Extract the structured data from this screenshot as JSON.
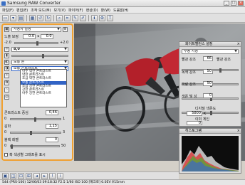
{
  "window": {
    "title": "Samsung RAW Converter",
    "minimize": "_",
    "maximize": "□",
    "close": "×"
  },
  "menu": [
    "파일(F)",
    "편집(E)",
    "조작 모드(M)",
    "보기(V)",
    "파이어(F)",
    "현상(D)",
    "창(W)",
    "도움말(H)"
  ],
  "toolbar_icons": [
    "folder-icon",
    "save-icon",
    "print-icon",
    "grid-icon",
    "rotate-left-icon",
    "rotate-right-icon",
    "zoom-icon",
    "crop-icon",
    "dropper-icon",
    "brush-icon",
    "info-icon",
    "gear-icon",
    "text-icon"
  ],
  "left_panel": {
    "preset": "사용자 설정",
    "exposure": {
      "label": "노출 보정",
      "value": "0.0",
      "value2": "0.0",
      "min": "-2.0",
      "max": "+2.0"
    },
    "wb_value": "8,0",
    "tone_select": "보통 톤",
    "contrast_select": "보통 콘트라스트",
    "contrast_options": [
      "아주 약한 콘트라스트",
      "약한 콘트라스트",
      "조금 약한 콘트라스트",
      "보통 콘트라스트",
      "조금 강한 콘트라스트",
      "강한 콘트라스트",
      "아주 강한 콘트라스트"
    ],
    "contrast_label": "콘트라스트 중심",
    "contrast_value": "0,46",
    "contrast_range": {
      "min": "0",
      "max": "1"
    },
    "gamma_label": "감마",
    "gamma_value": "1,15",
    "gamma_range": {
      "min": "0",
      "max": "3"
    },
    "black_label": "블랙 레벨",
    "black_value": "0",
    "black_range": {
      "min": "0",
      "max": "50"
    },
    "checkbox_label": "흑 색상별 그래프를 표시"
  },
  "wb_panel": {
    "title": "화이트밸런스 설정",
    "mode": "수동 지정",
    "red_label": "빨강 강조",
    "red_value": "66",
    "red_label2": "빨강 강조",
    "green_label": "녹색 강조",
    "green_value": "50",
    "blue_label": "파랑 강조",
    "blue_value": "50",
    "tint_label": "색온 빛 성",
    "tint_value": "0",
    "kelvin_label": "디지털 색온도",
    "kelvin_value": "5800",
    "kelvin_unit": "K",
    "gain_label": "이미 게인",
    "gain_value": "0"
  },
  "histogram_panel": {
    "title": "히스토그램"
  },
  "status": "544  (PRS-100) 12/06/03 09:18:32  F2.5 1/60  ISO 100  [매크로] 0.0EV  f/15mm"
}
